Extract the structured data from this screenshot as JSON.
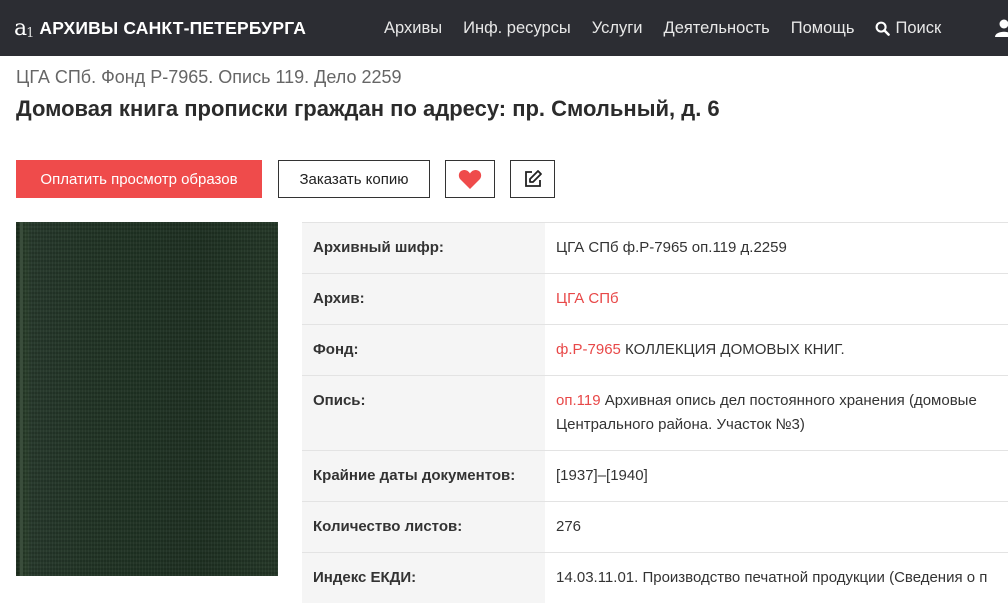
{
  "header": {
    "logo_mark": "a",
    "logo_sub": "1",
    "logo_text": "АРХИВЫ САНКТ-ПЕТЕРБУРГА",
    "nav": [
      "Архивы",
      "Инф. ресурсы",
      "Услуги",
      "Деятельность",
      "Помощь"
    ],
    "search_label": "Поиск",
    "bg_color": "#2c2d33"
  },
  "record": {
    "breadcrumb": "ЦГА СПб. Фонд Р-7965. Опись 119. Дело 2259",
    "title": "Домовая книга прописки граждан по адресу: пр. Смольный, д. 6"
  },
  "actions": {
    "pay_label": "Оплатить просмотр образов",
    "order_label": "Заказать копию",
    "accent_color": "#ef4b4b"
  },
  "details": {
    "cipher_label": "Архивный шифр:",
    "cipher_value": "ЦГА СПб ф.Р-7965 оп.119 д.2259",
    "archive_label": "Архив:",
    "archive_link": "ЦГА СПб",
    "fond_label": "Фонд:",
    "fond_link": "ф.Р-7965",
    "fond_text": " КОЛЛЕКЦИЯ ДОМОВЫХ КНИГ.",
    "inventory_label": "Опись:",
    "inventory_link": "оп.119",
    "inventory_text": " Архивная опись дел постоянного хранения (домовые",
    "inventory_text2": "Центрального района. Участок №3)",
    "dates_label": "Крайние даты документов:",
    "dates_value": "[1937]–[1940]",
    "sheets_label": "Количество листов:",
    "sheets_value": "276",
    "ekdi_label": "Индекс ЕКДИ:",
    "ekdi_value": "14.03.11.01. Производство печатной продукции (Сведения о п"
  }
}
